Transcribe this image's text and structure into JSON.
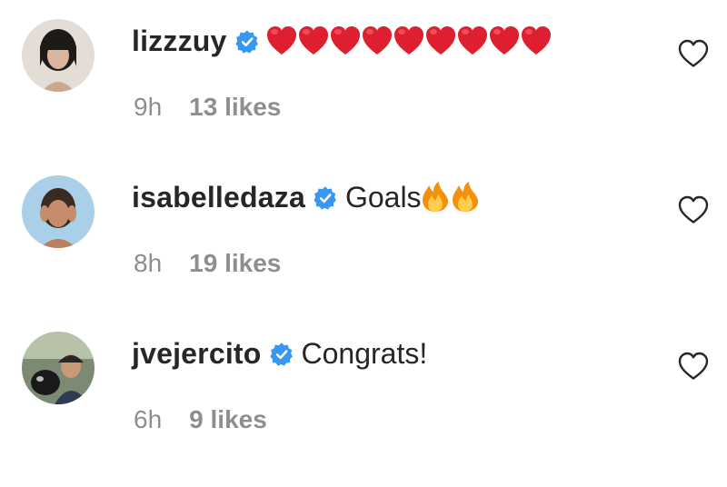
{
  "comments": [
    {
      "username": "lizzzuy",
      "text": "",
      "emoji": "red-heart",
      "emoji_count": 9,
      "time": "9h",
      "likes": "13 likes",
      "avatar_bg": "#d8cfc6"
    },
    {
      "username": "isabelledaza",
      "text": "Goals",
      "emoji": "fire",
      "emoji_count": 2,
      "time": "8h",
      "likes": "19 likes",
      "avatar_bg": "#a9cfe6"
    },
    {
      "username": "jvejercito",
      "text": "Congrats!",
      "emoji": "",
      "emoji_count": 0,
      "time": "6h",
      "likes": "9 likes",
      "avatar_bg": "#6a7a66"
    }
  ],
  "icons": {
    "verified": "verified-badge-icon",
    "like": "heart-outline-icon"
  },
  "colors": {
    "verified_blue": "#3897f0",
    "text": "#262626",
    "meta": "#8e8e8e",
    "heart_red": "#e0162b",
    "fire_orange": "#f4900c"
  }
}
